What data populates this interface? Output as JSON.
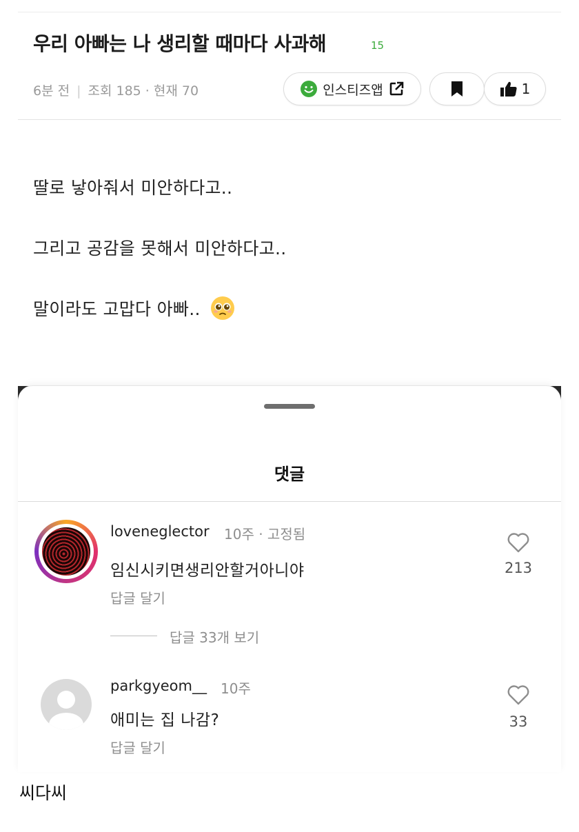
{
  "post": {
    "title": "우리 아빠는 나 생리할 때마다 사과해",
    "comment_count": "15",
    "meta_time": "6분 전",
    "meta_views": "조회 185 · 현재 70",
    "app_button_label": "인스티즈앱",
    "like_count": "1",
    "body_lines": [
      "딸로 낳아줘서 미안하다고..",
      "그리고 공감을 못해서 미안하다고..",
      "말이라도 고맙다 아빠.."
    ],
    "body_emoji": "pleading-face-emoji"
  },
  "comments_sheet": {
    "title": "댓글",
    "comments": [
      {
        "username": "loveneglector",
        "time": "10주 · 고정됨",
        "text": "임신시키면생리안할거아니야",
        "reply_label": "답글 달기",
        "likes": "213",
        "view_replies": "답글 33개 보기"
      },
      {
        "username": "parkgyeom__",
        "time": "10주",
        "text": "애미는 집 나감?",
        "reply_label": "답글 달기",
        "likes": "33"
      }
    ]
  },
  "footer_caption": "씨다씨",
  "colors": {
    "accent_green": "#3cab3c",
    "muted_text": "#8e8e8e"
  }
}
